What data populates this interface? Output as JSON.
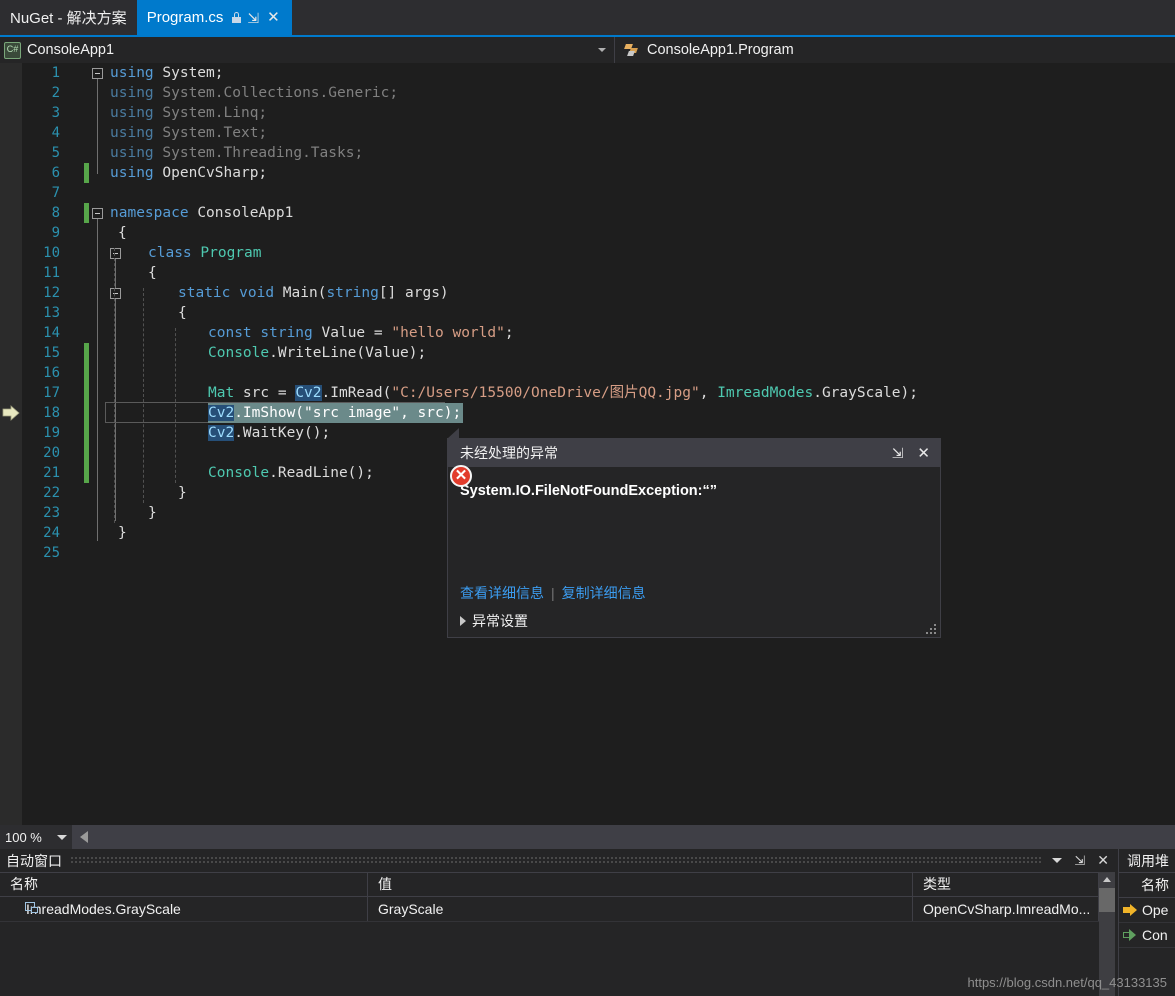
{
  "tabs": [
    {
      "label": "NuGet - 解决方案",
      "active": false,
      "icons": []
    },
    {
      "label": "Program.cs",
      "active": true,
      "icons": [
        "lock-icon",
        "pin-icon",
        "close-icon"
      ]
    }
  ],
  "navbar": {
    "left_scope": "ConsoleApp1",
    "left_icon": "csharp-file-icon",
    "right_scope": "ConsoleApp1.Program",
    "right_icon": "method-icon"
  },
  "editor": {
    "zoom_level": "100 %",
    "line_numbers": [
      "1",
      "2",
      "3",
      "4",
      "5",
      "6",
      "7",
      "8",
      "9",
      "10",
      "11",
      "12",
      "13",
      "14",
      "15",
      "16",
      "17",
      "18",
      "19",
      "20",
      "21",
      "22",
      "23",
      "24",
      "25"
    ],
    "lines": [
      {
        "n": 1,
        "text": "using System;"
      },
      {
        "n": 2,
        "text": "using System.Collections.Generic;"
      },
      {
        "n": 3,
        "text": "using System.Linq;"
      },
      {
        "n": 4,
        "text": "using System.Text;"
      },
      {
        "n": 5,
        "text": "using System.Threading.Tasks;"
      },
      {
        "n": 6,
        "text": "using OpenCvSharp;"
      },
      {
        "n": 7,
        "text": ""
      },
      {
        "n": 8,
        "text": "namespace ConsoleApp1"
      },
      {
        "n": 9,
        "text": "{"
      },
      {
        "n": 10,
        "text": "    class Program"
      },
      {
        "n": 11,
        "text": "    {"
      },
      {
        "n": 12,
        "text": "        static void Main(string[] args)"
      },
      {
        "n": 13,
        "text": "        {"
      },
      {
        "n": 14,
        "text": "            const string Value = \"hello world\";"
      },
      {
        "n": 15,
        "text": "            Console.WriteLine(Value);"
      },
      {
        "n": 16,
        "text": ""
      },
      {
        "n": 17,
        "text": "            Mat src = Cv2.ImRead(\"C:/Users/15500/OneDrive/图片QQ.jpg\", ImreadModes.GrayScale);"
      },
      {
        "n": 18,
        "text": "            Cv2.ImShow(\"src image\", src);"
      },
      {
        "n": 19,
        "text": "            Cv2.WaitKey();"
      },
      {
        "n": 20,
        "text": ""
      },
      {
        "n": 21,
        "text": "            Console.ReadLine();"
      },
      {
        "n": 22,
        "text": "        }"
      },
      {
        "n": 23,
        "text": "    }"
      },
      {
        "n": 24,
        "text": "}"
      },
      {
        "n": 25,
        "text": ""
      }
    ],
    "tokens": {
      "using": "using",
      "namespace": "namespace",
      "class": "class",
      "static": "static",
      "void": "void",
      "const": "const",
      "string_kw": "string",
      "ns_system": "System;",
      "ns_collections": "System.Collections.Generic;",
      "ns_linq": "System.Linq;",
      "ns_text": "System.Text;",
      "ns_threading": "System.Threading.Tasks;",
      "ns_opencv": "OpenCvSharp;",
      "ns_name": "ConsoleApp1",
      "class_name": "Program",
      "main_sig_pre": "Main(",
      "main_sig_post": "[] args)",
      "const_value_name": " Value = ",
      "const_value_str": "\"hello world\"",
      "semi": ";",
      "console": "Console",
      "writeline": ".WriteLine(Value);",
      "readline": ".ReadLine();",
      "mat": "Mat",
      "src_assign": " src = ",
      "cv2": "Cv2",
      "imread_open": ".ImRead(",
      "imread_path": "\"C:/Users/15500/OneDrive/图片QQ.jpg\"",
      "imread_comma": ", ",
      "imread_modes": "ImreadModes",
      "imread_gray": ".GrayScale);",
      "imshow": ".ImShow(",
      "imshow_str": "\"src image\"",
      "imshow_rest": ", src);",
      "waitkey": ".WaitKey();",
      "brace_open": "{",
      "brace_close": "}"
    },
    "error_marker": "error-icon"
  },
  "exception_popup": {
    "title": "未经处理的异常",
    "message": "System.IO.FileNotFoundException:“”",
    "link_view": "查看详细信息",
    "link_copy": "复制详细信息",
    "settings": "异常设置",
    "pin_icon": "pin-icon",
    "close_icon": "close-icon"
  },
  "autos_panel": {
    "title": "自动窗口",
    "columns": [
      "名称",
      "值",
      "类型"
    ],
    "rows": [
      {
        "name": "ImreadModes.GrayScale",
        "value": "GrayScale",
        "type": "OpenCvSharp.ImreadMo..."
      }
    ]
  },
  "callstack_panel": {
    "title": "调用堆",
    "column": "名称",
    "rows": [
      {
        "icon": "yellow-arrow-icon",
        "label": "Ope"
      },
      {
        "icon": "green-arrow-icon",
        "label": "Con"
      }
    ]
  },
  "watermark": "https://blog.csdn.net/qq_43133135",
  "colors": {
    "accent": "#007acc",
    "editor_bg": "#1e1e1e",
    "chrome_bg": "#2d2d30",
    "panel_bg": "#252526",
    "keyword": "#569cd6",
    "type": "#4ec9b0",
    "string": "#d69d85",
    "linenum": "#2b91af",
    "dim_text": "#808080",
    "error_red": "#e23c2c",
    "change_bar_green": "#57a64a",
    "current_stmt": "#6b8a8a",
    "link_blue": "#3b9cf0"
  }
}
